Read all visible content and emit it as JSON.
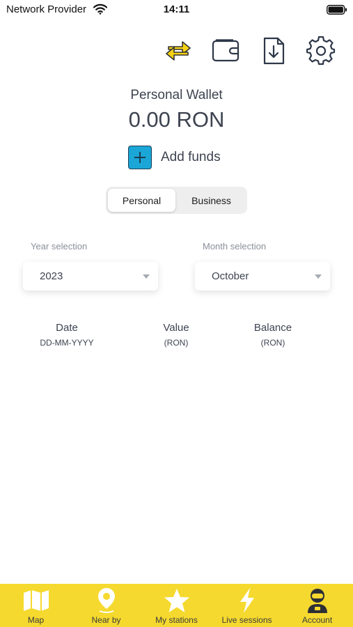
{
  "status_bar": {
    "carrier": "Network Provider",
    "time": "14:11"
  },
  "toolbar": {
    "icons": [
      "transfer-icon",
      "wallet-icon",
      "download-document-icon",
      "gear-icon"
    ],
    "accent": "#f5d92e"
  },
  "wallet": {
    "title": "Personal Wallet",
    "balance": "0.00 RON",
    "add_funds_label": "Add funds",
    "add_funds_color": "#1aa6d6"
  },
  "segments": {
    "options": [
      "Personal",
      "Business"
    ],
    "selected": "Personal"
  },
  "filters": {
    "year_label": "Year selection",
    "year_value": "2023",
    "month_label": "Month selection",
    "month_value": "October"
  },
  "table": {
    "columns": [
      {
        "title": "Date",
        "sub": "DD-MM-YYYY"
      },
      {
        "title": "Value",
        "sub": "(RON)"
      },
      {
        "title": "Balance",
        "sub": "(RON)"
      }
    ]
  },
  "tab_bar": {
    "background": "#f5d92e",
    "items": [
      {
        "label": "Map",
        "icon": "map-icon"
      },
      {
        "label": "Near by",
        "icon": "location-pin-icon"
      },
      {
        "label": "My stations",
        "icon": "star-icon"
      },
      {
        "label": "Live sessions",
        "icon": "lightning-icon"
      },
      {
        "label": "Account",
        "icon": "account-avatar-icon"
      }
    ]
  }
}
